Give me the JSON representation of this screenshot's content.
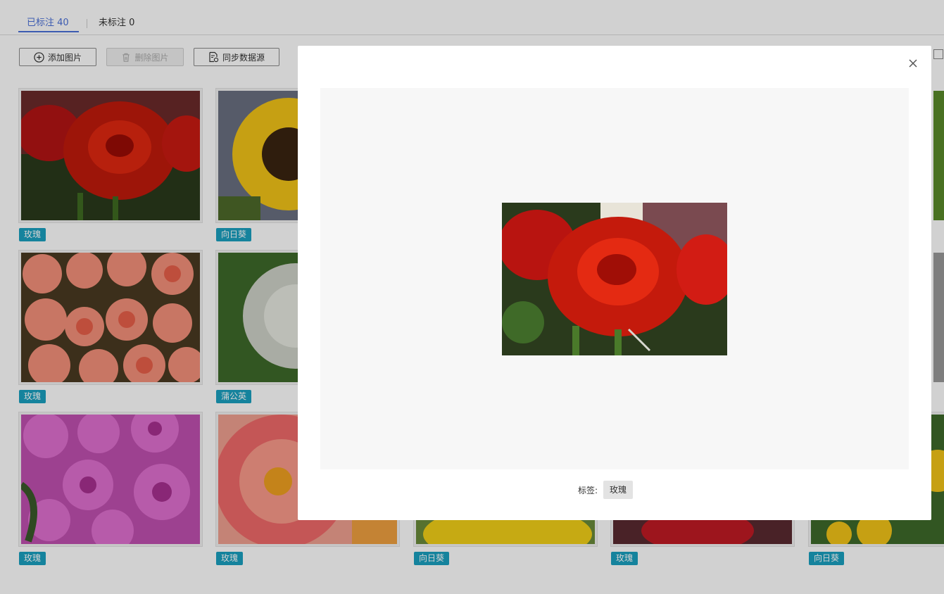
{
  "tabs": [
    {
      "label": "已标注 40"
    },
    {
      "label": "未标注 0"
    }
  ],
  "toolbar": {
    "add_label": "添加图片",
    "delete_label": "删除图片",
    "sync_label": "同步数据源"
  },
  "grid": {
    "cards": [
      {
        "tag": "玫瑰"
      },
      {
        "tag": "向日葵"
      },
      {
        "tag": "玫瑰"
      },
      {
        "tag": "蒲公英"
      },
      {
        "tag": "玫瑰"
      },
      {
        "tag": "玫瑰"
      },
      {
        "tag": "向日葵"
      },
      {
        "tag": "玫瑰"
      },
      {
        "tag": "向日葵"
      }
    ]
  },
  "modal": {
    "label_key": "标签:",
    "label_value": "玫瑰"
  },
  "colors": {
    "accent": "#4a6fd8",
    "tag_bg": "#1aa0c0"
  }
}
